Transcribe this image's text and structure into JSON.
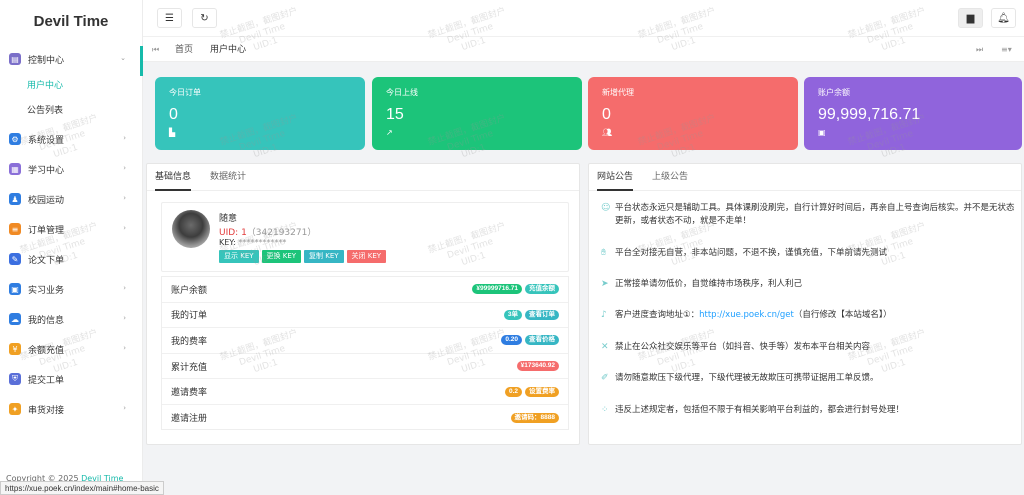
{
  "app": {
    "title": "Devil Time"
  },
  "sidebar": {
    "items": [
      {
        "label": "控制中心",
        "icon": "dashboard-icon",
        "color": "#7b6fc9"
      },
      {
        "label": "系统设置",
        "icon": "gear-icon",
        "color": "#2f7de1"
      },
      {
        "label": "学习中心",
        "icon": "grid-icon",
        "color": "#8a6fd8"
      },
      {
        "label": "校园运动",
        "icon": "running-icon",
        "color": "#2f7de1"
      },
      {
        "label": "订单管理",
        "icon": "order-icon",
        "color": "#f08a24"
      },
      {
        "label": "论文下单",
        "icon": "pen-icon",
        "color": "#3b6fe0"
      },
      {
        "label": "实习业务",
        "icon": "calendar-icon",
        "color": "#2f7de1"
      },
      {
        "label": "我的信息",
        "icon": "cloud-icon",
        "color": "#2f7de1"
      },
      {
        "label": "余额充值",
        "icon": "coin-icon",
        "color": "#f0a023"
      },
      {
        "label": "提交工单",
        "icon": "shield-icon",
        "color": "#5a6fd8"
      },
      {
        "label": "串货对接",
        "icon": "compass-icon",
        "color": "#f0a023"
      }
    ],
    "subitems": [
      "用户中心",
      "公告列表"
    ],
    "copyright_prefix": "Copyright © 2025",
    "copyright_brand": "Devil Time"
  },
  "statusbar": {
    "url": "https://xue.poek.cn/index/main#home-basic"
  },
  "tabs": {
    "home": "首页",
    "current": "用户中心"
  },
  "cards": [
    {
      "title": "今日订单",
      "value": "0",
      "color": "#36c4bb"
    },
    {
      "title": "今日上线",
      "value": "15",
      "color": "#1cc47a"
    },
    {
      "title": "新增代理",
      "value": "0",
      "color": "#f56c6c"
    },
    {
      "title": "账户余额",
      "value": "99,999,716.71",
      "color": "#9064dc"
    }
  ],
  "basic": {
    "tabs": [
      "基础信息",
      "数据统计"
    ],
    "profile": {
      "name": "随意",
      "uid_label": "UID: 1",
      "uid_extra": "（342193271）",
      "key_label": "KEY:",
      "key_value": "************",
      "buttons": [
        {
          "label": "显示 KEY",
          "color": "#36c4bb"
        },
        {
          "label": "更换 KEY",
          "color": "#1cc47a"
        },
        {
          "label": "复制 KEY",
          "color": "#36b6c4"
        },
        {
          "label": "关闭 KEY",
          "color": "#f56c6c"
        }
      ]
    },
    "rows": [
      {
        "label": "账户余额",
        "badges": [
          {
            "text": "¥99999716.71",
            "color": "#1cc47a"
          },
          {
            "text": "充值余额",
            "color": "#36c4bb"
          }
        ]
      },
      {
        "label": "我的订单",
        "badges": [
          {
            "text": "3单",
            "color": "#36c4bb"
          },
          {
            "text": "查看订单",
            "color": "#36b6c4"
          }
        ]
      },
      {
        "label": "我的费率",
        "badges": [
          {
            "text": "0.20",
            "color": "#2f7de1"
          },
          {
            "text": "查看价格",
            "color": "#36b6c4"
          }
        ]
      },
      {
        "label": "累计充值",
        "badges": [
          {
            "text": "¥173640.92",
            "color": "#f56c6c"
          }
        ]
      },
      {
        "label": "邀请费率",
        "badges": [
          {
            "text": "0.2",
            "color": "#f0a023"
          },
          {
            "text": "设置费率",
            "color": "#f0a023"
          }
        ]
      },
      {
        "label": "邀请注册",
        "badges": [
          {
            "text": "邀请码：8888",
            "color": "#f0a023"
          }
        ]
      }
    ]
  },
  "notice": {
    "tabs": [
      "网站公告",
      "上级公告"
    ],
    "items": [
      {
        "icon": "smile-icon",
        "text": "平台状态永远只是辅助工具。具体课刷没刷完，自行计算好时间后，再亲自上号查询后核实。并不是无状态更新，或者状态不动，就是不走单！"
      },
      {
        "icon": "hand-icon",
        "text": "平台全对接无自营，非本站问题，不退不换，谨慎充值，下单前请先测试"
      },
      {
        "icon": "send-icon",
        "text": "正常接单请勿低价，自觉维持市场秩序，利人利己"
      },
      {
        "icon": "bell-icon",
        "text": "客户进度查询地址①：",
        "link": "http://xue.poek.cn/get",
        "after": "（自行修改【本站域名】）"
      },
      {
        "icon": "close-icon",
        "text": "禁止在公众社交娱乐等平台（如抖音、快手等）发布本平台相关内容"
      },
      {
        "icon": "edit-icon",
        "text": "请勿随意欺压下级代理，下级代理被无故欺压可携带证据用工单反馈。"
      },
      {
        "icon": "loading-icon",
        "text": "违反上述规定者，包括但不限于有相关影响平台利益的，都会进行封号处理！"
      }
    ]
  },
  "watermark": {
    "line1": "禁止截图，截图封户",
    "line2": "Devil Time",
    "line3": "UID:1"
  }
}
